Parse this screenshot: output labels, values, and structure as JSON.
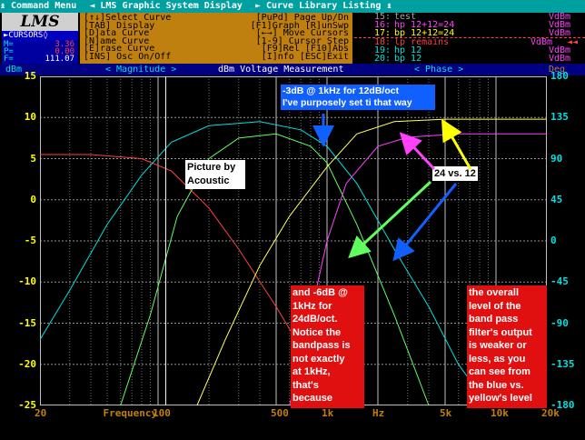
{
  "app": {
    "logo": "LMS"
  },
  "menubar": {
    "items": [
      "↨ Command Menu",
      "◄ LMS Graphic System Display",
      "► Curve Library Listing ↨"
    ]
  },
  "cursors": {
    "title": "►CURSORS◊",
    "m_label": "M=",
    "m_value": "3.36",
    "p_label": "P=",
    "p_value": "0.00",
    "f_label": "F=",
    "f_value": "111.07"
  },
  "commands": {
    "rows": [
      [
        "[↑↓]Select Curve",
        "[PuPd] Page Up/Dn"
      ],
      [
        "[TAB] Display",
        "[F1]Graph [R]unSwp"
      ],
      [
        "[D]ata  Curve",
        "[←→] Move Cursors"
      ],
      [
        "[N]ame  Curve",
        "[1-9] Cursor Step"
      ],
      [
        "[E]rase Curve",
        "[F9]Rel [F10]Abs"
      ],
      [
        "[INS] Osc On/Off",
        "[I]nfo  [ESC]Exit"
      ]
    ]
  },
  "curves": [
    {
      "num": "15:",
      "name": "test",
      "unit": "VdBm",
      "color": "#a0a0a0",
      "marker": ""
    },
    {
      "num": "16:",
      "name": "hp 12+12=24",
      "unit": "VdBm",
      "color": "#ff40ff",
      "marker": ""
    },
    {
      "num": "17:",
      "name": "bp 12+12=24",
      "unit": "VdBm",
      "color": "#ffff00",
      "marker": ""
    },
    {
      "num": "18:",
      "name": "lp remains",
      "unit": "VdBm",
      "color": "#ff4040",
      "marker": "◄◄"
    },
    {
      "num": "19:",
      "name": "hp 12",
      "unit": "VdBm",
      "color": "#00e0e0",
      "marker": ""
    },
    {
      "num": "20:",
      "name": "bp 12",
      "unit": "VdBm",
      "color": "#00e0e0",
      "marker": ""
    }
  ],
  "header": {
    "left_unit": "dBm",
    "magnitude": "< Magnitude >",
    "measurement": "dBm Voltage Measurement",
    "phase": "< Phase >",
    "right_unit": "Deg"
  },
  "chart_data": {
    "type": "line",
    "xscale": "log",
    "xlim": [
      20,
      20000
    ],
    "ylim": [
      -25,
      15
    ],
    "y2lim": [
      -180,
      180
    ],
    "x_ticks": [
      {
        "v": 20,
        "label": "20"
      },
      {
        "v": 45,
        "label": "Frequency"
      },
      {
        "v": 100,
        "label": "100"
      },
      {
        "v": 500,
        "label": "500"
      },
      {
        "v": 1000,
        "label": "1k"
      },
      {
        "v": 2000,
        "label": "Hz"
      },
      {
        "v": 5000,
        "label": "5k"
      },
      {
        "v": 10000,
        "label": "10k"
      },
      {
        "v": 20000,
        "label": "20k"
      }
    ],
    "y_ticks": [
      "15",
      "10",
      "5",
      "0",
      "-5",
      "-10",
      "-15",
      "-20",
      "-25"
    ],
    "y2_ticks": [
      "180",
      "135",
      "90",
      "45",
      "0",
      "-45",
      "-90",
      "-135",
      "-180"
    ],
    "grid": true,
    "series": [
      {
        "color": "#ff4040",
        "points": [
          [
            20,
            5.5
          ],
          [
            40,
            5.5
          ],
          [
            80,
            5
          ],
          [
            120,
            3.5
          ],
          [
            200,
            -1
          ],
          [
            300,
            -6
          ],
          [
            500,
            -13
          ],
          [
            800,
            -20
          ],
          [
            1200,
            -25
          ]
        ]
      },
      {
        "color": "#00e0e0",
        "points": [
          [
            20,
            -17
          ],
          [
            30,
            -11
          ],
          [
            50,
            -3
          ],
          [
            80,
            3
          ],
          [
            120,
            7
          ],
          [
            200,
            9
          ],
          [
            400,
            9.5
          ],
          [
            700,
            8.5
          ],
          [
            1000,
            6.5
          ],
          [
            1500,
            2
          ],
          [
            2500,
            -6
          ],
          [
            4000,
            -13
          ],
          [
            6000,
            -20
          ],
          [
            9000,
            -25
          ]
        ]
      },
      {
        "color": "#60ff60",
        "points": [
          [
            60,
            -25
          ],
          [
            90,
            -14
          ],
          [
            130,
            -2
          ],
          [
            200,
            5
          ],
          [
            300,
            7.5
          ],
          [
            500,
            8
          ],
          [
            800,
            6.5
          ],
          [
            1000,
            4.5
          ],
          [
            1500,
            -3
          ],
          [
            2500,
            -14
          ],
          [
            4000,
            -25
          ]
        ]
      },
      {
        "color": "#ffff60",
        "points": [
          [
            170,
            -25
          ],
          [
            250,
            -17
          ],
          [
            400,
            -8
          ],
          [
            600,
            -2
          ],
          [
            1000,
            4
          ],
          [
            1500,
            8
          ],
          [
            2500,
            9.5
          ],
          [
            5000,
            9.8
          ],
          [
            20000,
            9.8
          ]
        ]
      },
      {
        "color": "#ff40ff",
        "points": [
          [
            600,
            -25
          ],
          [
            800,
            -14
          ],
          [
            1000,
            -5
          ],
          [
            1300,
            2
          ],
          [
            2000,
            6.5
          ],
          [
            3000,
            7.6
          ],
          [
            6000,
            8
          ],
          [
            20000,
            8
          ]
        ]
      }
    ],
    "annotations": [
      {
        "text": "-3dB @ 1kHz for 12dB/oct\nI've purposely set ti that way",
        "style": "blue"
      },
      {
        "text": "Picture by\nAcoustic",
        "style": "white"
      },
      {
        "text": "24 vs. 12",
        "style": "white"
      },
      {
        "text": "and -6dB @\n1kHz for\n24dB/oct.\nNotice the\nbandpass is\nnot exactly\nat 1kHz,\nthat's\nbecause",
        "style": "red"
      },
      {
        "text": "the overall\nlevel of the\nband pass\nfilter's output\nis weaker or\nless, as you\ncan see from\nthe blue vs.\nyellow's level",
        "style": "red"
      }
    ]
  }
}
